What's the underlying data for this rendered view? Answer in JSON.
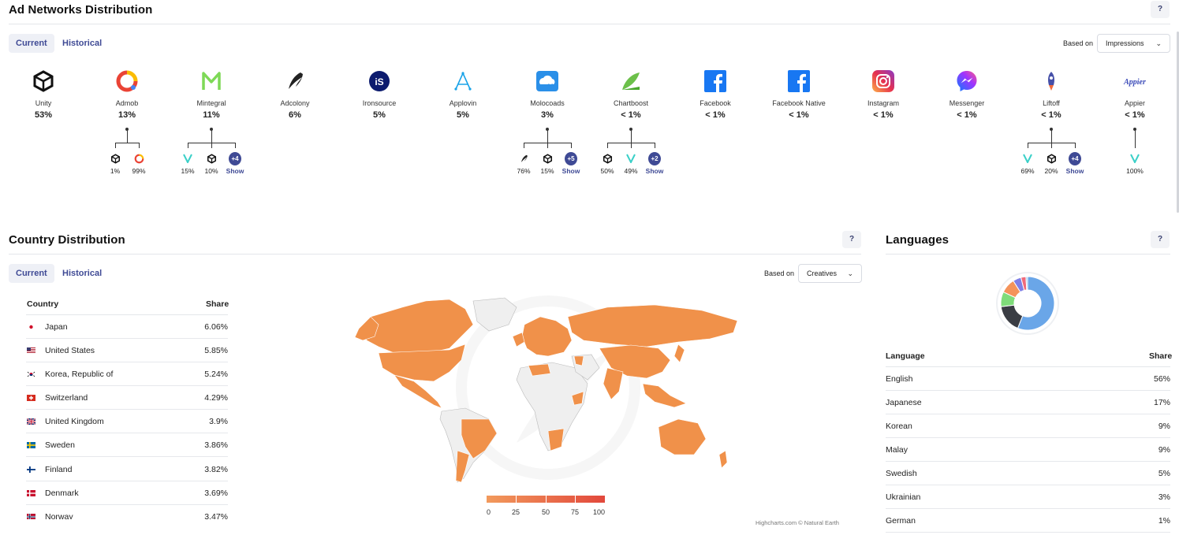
{
  "ad_networks": {
    "title": "Ad Networks Distribution",
    "help": "?",
    "tabs": [
      "Current",
      "Historical"
    ],
    "based_on_label": "Based on",
    "based_on_value": "Impressions",
    "networks": [
      {
        "name": "Unity",
        "pct": "53%",
        "icon": "unity-icon"
      },
      {
        "name": "Admob",
        "pct": "13%",
        "icon": "admob-icon"
      },
      {
        "name": "Mintegral",
        "pct": "11%",
        "icon": "mintegral-icon"
      },
      {
        "name": "Adcolony",
        "pct": "6%",
        "icon": "adcolony-icon"
      },
      {
        "name": "Ironsource",
        "pct": "5%",
        "icon": "ironsource-icon"
      },
      {
        "name": "Applovin",
        "pct": "5%",
        "icon": "applovin-icon"
      },
      {
        "name": "Molocoads",
        "pct": "3%",
        "icon": "moloco-icon"
      },
      {
        "name": "Chartboost",
        "pct": "< 1%",
        "icon": "chartboost-icon"
      },
      {
        "name": "Facebook",
        "pct": "< 1%",
        "icon": "facebook-icon"
      },
      {
        "name": "Facebook Native",
        "pct": "< 1%",
        "icon": "facebook-icon"
      },
      {
        "name": "Instagram",
        "pct": "< 1%",
        "icon": "instagram-icon"
      },
      {
        "name": "Messenger",
        "pct": "< 1%",
        "icon": "messenger-icon"
      },
      {
        "name": "Liftoff",
        "pct": "< 1%",
        "icon": "liftoff-icon"
      },
      {
        "name": "Appier",
        "pct": "< 1%",
        "icon": "appier-icon"
      }
    ],
    "subnets": {
      "admob": [
        "1%",
        "99%"
      ],
      "mintegral": [
        "15%",
        "10%",
        "+4",
        "Show"
      ],
      "molocoads": [
        "76%",
        "15%",
        "+5",
        "Show"
      ],
      "chartboost": [
        "50%",
        "49%",
        "+2",
        "Show"
      ],
      "liftoff": [
        "69%",
        "20%",
        "+4",
        "Show"
      ],
      "appier": [
        "100%"
      ]
    }
  },
  "country": {
    "title": "Country Distribution",
    "help": "?",
    "tabs": [
      "Current",
      "Historical"
    ],
    "based_on_label": "Based on",
    "based_on_value": "Creatives",
    "col_country": "Country",
    "col_share": "Share",
    "rows": [
      {
        "name": "Japan",
        "share": "6.06%"
      },
      {
        "name": "United States",
        "share": "5.85%"
      },
      {
        "name": "Korea, Republic of",
        "share": "5.24%"
      },
      {
        "name": "Switzerland",
        "share": "4.29%"
      },
      {
        "name": "United Kingdom",
        "share": "3.9%"
      },
      {
        "name": "Sweden",
        "share": "3.86%"
      },
      {
        "name": "Finland",
        "share": "3.82%"
      },
      {
        "name": "Denmark",
        "share": "3.69%"
      },
      {
        "name": "Norway",
        "share": "3.47%"
      }
    ],
    "legend": [
      "0",
      "25",
      "50",
      "75",
      "100"
    ],
    "credit": "Highcharts.com © Natural Earth"
  },
  "languages": {
    "title": "Languages",
    "help": "?",
    "col_language": "Language",
    "col_share": "Share",
    "rows": [
      {
        "name": "English",
        "share": "56%"
      },
      {
        "name": "Japanese",
        "share": "17%"
      },
      {
        "name": "Korean",
        "share": "9%"
      },
      {
        "name": "Malay",
        "share": "9%"
      },
      {
        "name": "Swedish",
        "share": "5%"
      },
      {
        "name": "Ukrainian",
        "share": "3%"
      },
      {
        "name": "German",
        "share": "1%"
      }
    ],
    "donut_colors": [
      "#6aa6e8",
      "#3a3d44",
      "#7fdc7a",
      "#f4935a",
      "#7f7fe6",
      "#f06a7a",
      "#8fc8f0"
    ]
  },
  "colors": {
    "accent": "#3f4a95",
    "map_fill": "#f0914a",
    "map_empty": "#efefef"
  }
}
